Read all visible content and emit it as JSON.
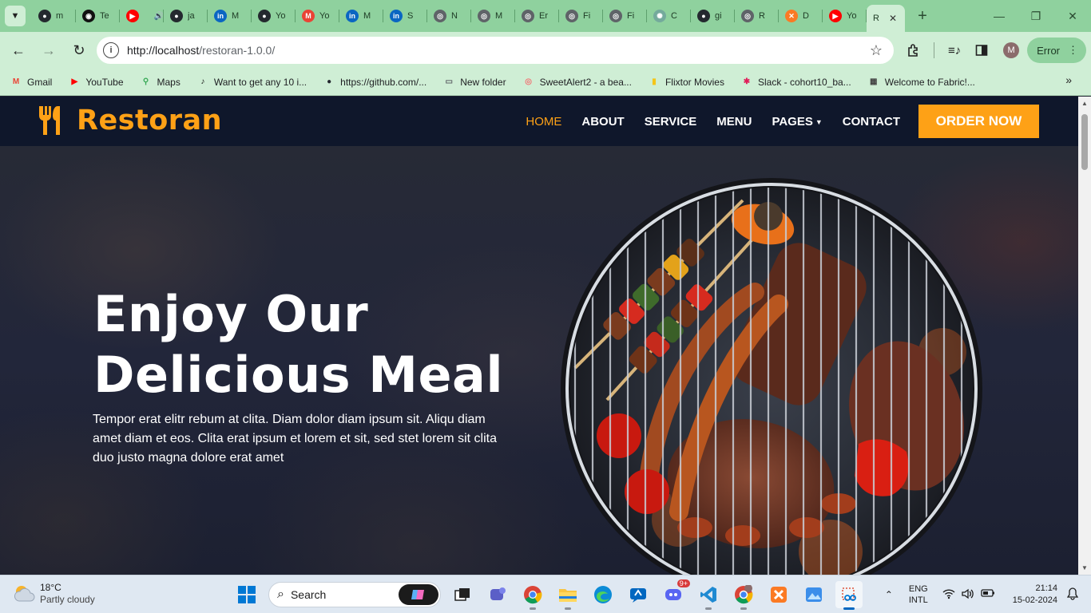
{
  "browser": {
    "tabs": [
      {
        "title": "m",
        "icon": "github-icon",
        "color": "#24292f"
      },
      {
        "title": "Te",
        "icon": "media-icon",
        "color": "#111111"
      },
      {
        "title": "",
        "icon": "youtube-icon",
        "color": "#ff0000"
      },
      {
        "title": "ja",
        "icon": "github-icon",
        "color": "#24292f"
      },
      {
        "title": "M",
        "icon": "linkedin-icon",
        "color": "#0a66c2"
      },
      {
        "title": "Yo",
        "icon": "github-icon",
        "color": "#24292f"
      },
      {
        "title": "Yo",
        "icon": "gmail-icon",
        "color": "#ea4335"
      },
      {
        "title": "M",
        "icon": "linkedin-icon",
        "color": "#0a66c2"
      },
      {
        "title": "S",
        "icon": "linkedin-icon",
        "color": "#0a66c2"
      },
      {
        "title": "N",
        "icon": "chrome-icon",
        "color": "#5f6368"
      },
      {
        "title": "M",
        "icon": "globe-icon",
        "color": "#5f6368"
      },
      {
        "title": "Er",
        "icon": "globe-icon",
        "color": "#5f6368"
      },
      {
        "title": "Fi",
        "icon": "globe-icon",
        "color": "#5f6368"
      },
      {
        "title": "Fi",
        "icon": "globe-icon",
        "color": "#5f6368"
      },
      {
        "title": "C",
        "icon": "openai-icon",
        "color": "#74aa9c"
      },
      {
        "title": "gi",
        "icon": "github-icon",
        "color": "#24292f"
      },
      {
        "title": "R",
        "icon": "globe-icon",
        "color": "#5f6368"
      },
      {
        "title": "D",
        "icon": "xampp-icon",
        "color": "#fb7a24"
      },
      {
        "title": "Yo",
        "icon": "youtube-icon",
        "color": "#ff0000"
      }
    ],
    "active_tab": {
      "title": "R",
      "icon": "globe-icon"
    },
    "url_host": "http://localhost",
    "url_path": "/restoran-1.0.0/",
    "profile_initial": "M",
    "error_label": "Error",
    "bookmarks": [
      {
        "label": "Gmail",
        "icon": "gmail-icon",
        "color": "#ea4335"
      },
      {
        "label": "YouTube",
        "icon": "youtube-icon",
        "color": "#ff0000"
      },
      {
        "label": "Maps",
        "icon": "maps-icon",
        "color": "#34a853"
      },
      {
        "label": "Want to get any 10 i...",
        "icon": "tiktok-icon",
        "color": "#111111"
      },
      {
        "label": "https://github.com/...",
        "icon": "github-icon",
        "color": "#24292f"
      },
      {
        "label": "New folder",
        "icon": "folder-icon",
        "color": "#5f6368"
      },
      {
        "label": "SweetAlert2 - a bea...",
        "icon": "sweetalert-icon",
        "color": "#f27474"
      },
      {
        "label": "Flixtor Movies",
        "icon": "flixtor-icon",
        "color": "#f5c518"
      },
      {
        "label": "Slack - cohort10_ba...",
        "icon": "slack-icon",
        "color": "#e01e5a"
      },
      {
        "label": "Welcome to Fabric!...",
        "icon": "fabric-icon",
        "color": "#444444"
      }
    ]
  },
  "site": {
    "brand": "Restoran",
    "nav": [
      {
        "label": "Home",
        "active": true
      },
      {
        "label": "About",
        "active": false
      },
      {
        "label": "Service",
        "active": false
      },
      {
        "label": "Menu",
        "active": false
      },
      {
        "label": "Pages",
        "active": false,
        "dropdown": true
      },
      {
        "label": "Contact",
        "active": false
      }
    ],
    "cta": "Order Now",
    "hero": {
      "title_line1": "Enjoy Our",
      "title_line2": "Delicious Meal",
      "text": "Tempor erat elitr rebum at clita. Diam dolor diam ipsum sit. Aliqu diam amet diam et eos. Clita erat ipsum et lorem et sit, sed stet lorem sit clita duo justo magna dolore erat amet"
    },
    "colors": {
      "primary": "#fea116",
      "dark": "#0f172b"
    }
  },
  "taskbar": {
    "weather_temp": "18°C",
    "weather_cond": "Partly cloudy",
    "search_label": "Search",
    "apps": [
      "task-view-icon",
      "teams-icon",
      "chrome-icon",
      "file-explorer-icon",
      "edge-icon",
      "copilot-app-icon",
      "discord-icon",
      "vscode-icon",
      "chrome-profile-icon",
      "xampp-icon",
      "photos-icon",
      "snipping-tool-icon"
    ],
    "discord_badge": "9+",
    "lang_line1": "ENG",
    "lang_line2": "INTL",
    "time": "21:14",
    "date": "15-02-2024"
  }
}
